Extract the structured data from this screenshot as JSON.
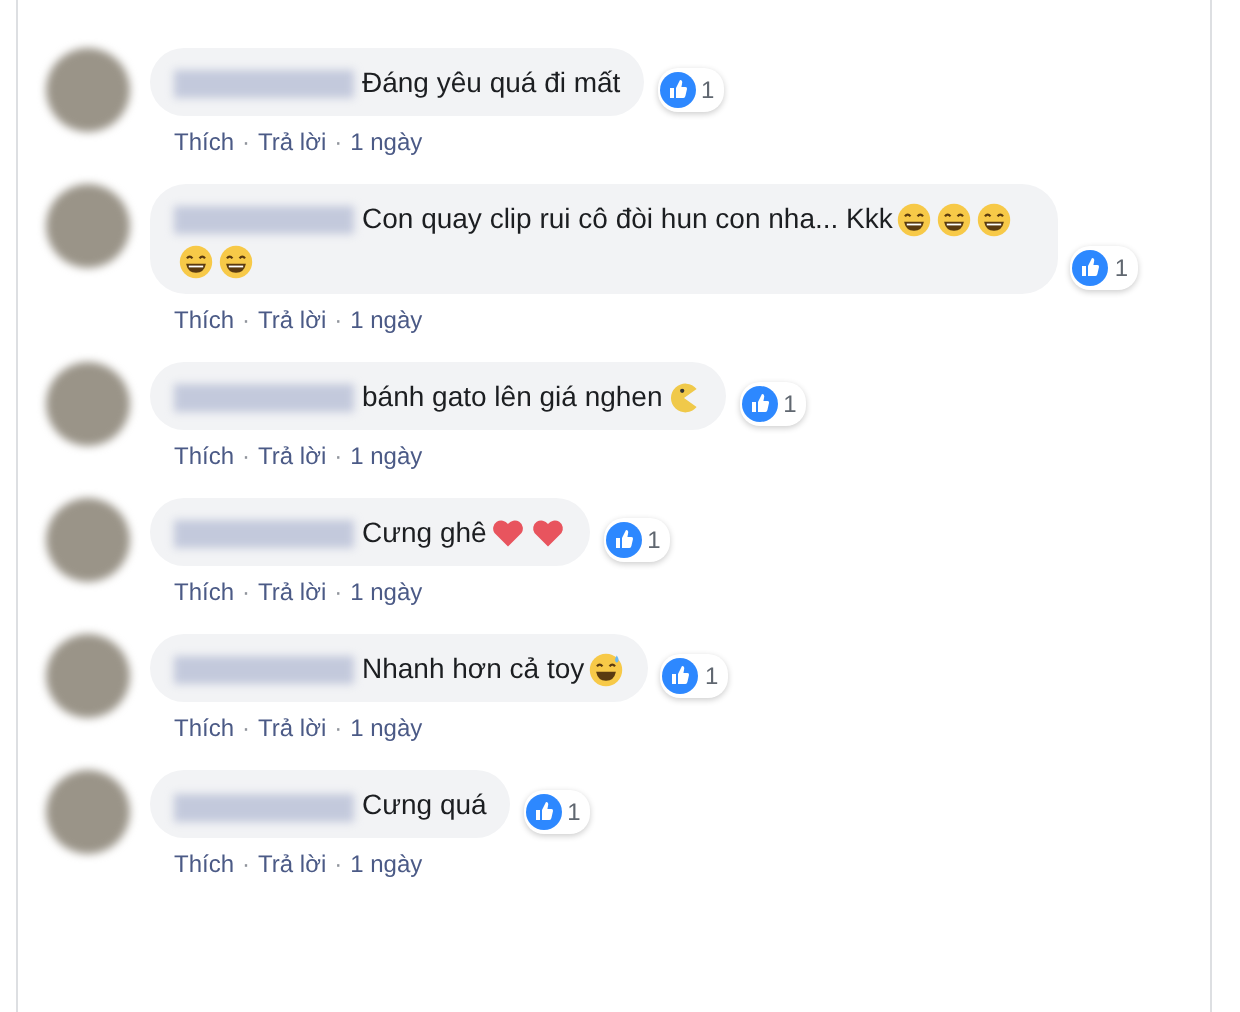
{
  "comments": [
    {
      "text": "Đáng yêu quá đi mất",
      "likes": "1",
      "actions": [
        "Thích",
        "Trả lời"
      ],
      "separator": "·",
      "time": "1 ngày"
    },
    {
      "text": "Con quay clip rui cô đòi hun con nha... Kkk",
      "emojis": [
        {
          "kind": "laugh"
        },
        {
          "kind": "laugh"
        },
        {
          "kind": "laugh"
        },
        {
          "kind": "laugh"
        },
        {
          "kind": "laugh"
        }
      ],
      "likes": "1",
      "actions": [
        "Thích",
        "Trả lời"
      ],
      "separator": "·",
      "time": "1 ngày"
    },
    {
      "text": "bánh gato lên giá nghen",
      "emojis": [
        {
          "kind": "pacman"
        }
      ],
      "likes": "1",
      "actions": [
        "Thích",
        "Trả lời"
      ],
      "separator": "·",
      "time": "1 ngày"
    },
    {
      "text": "Cưng ghê",
      "emojis": [
        {
          "kind": "heart"
        },
        {
          "kind": "heart"
        }
      ],
      "likes": "1",
      "actions": [
        "Thích",
        "Trả lời"
      ],
      "separator": "·",
      "time": "1 ngày"
    },
    {
      "text": "Nhanh hơn cả toy",
      "emojis": [
        {
          "kind": "sweat"
        }
      ],
      "likes": "1",
      "actions": [
        "Thích",
        "Trả lời"
      ],
      "separator": "·",
      "time": "1 ngày"
    },
    {
      "text": "Cưng quá",
      "likes": "1",
      "actions": [
        "Thích",
        "Trả lời"
      ],
      "separator": "·",
      "time": "1 ngày"
    }
  ]
}
